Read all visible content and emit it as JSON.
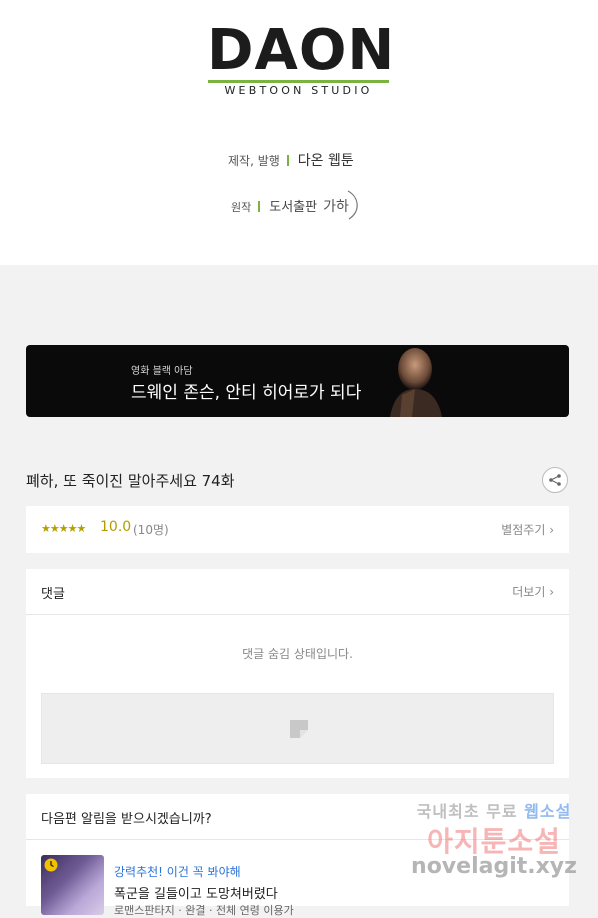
{
  "logo": {
    "word": "DAON",
    "subtitle": "WEBTOON STUDIO",
    "accent_color": "#7ab33f"
  },
  "credits": {
    "production_label": "제작, 발행",
    "production_value": "다온 웹툰",
    "original_label": "원작",
    "original_value": "도서출판",
    "publisher_mark": "가하"
  },
  "ad": {
    "kicker": "영화 블랙 아담",
    "title": "드웨인 존슨, 안티 히어로가 되다"
  },
  "episode": {
    "title": "폐하, 또 죽이진 말아주세요 74화",
    "share_icon": "share-icon"
  },
  "rating": {
    "stars": "★★★★★",
    "score": "10.0",
    "votes": "(10명)",
    "rate_link": "별점주기 ›",
    "star_color": "#b5a000"
  },
  "comments": {
    "title": "댓글",
    "more_link": "더보기 ›",
    "hidden_notice": "댓글 숨김 상태입니다."
  },
  "notify": {
    "question": "다음편 알림을 받으시겠습니까?",
    "reco_tag": "강력추천! 이건 꼭 봐야해",
    "reco_title": "폭군을 길들이고 도망쳐버렸다",
    "reco_meta": "로맨스판타지 · 완결 · 전체 연령 이용가",
    "tag_color": "#2b73d6"
  },
  "watermark": {
    "line1_a": "국내최초 무료",
    "line1_b": "웹소설",
    "line2": "아지툰소설",
    "line3": "novelagit.xyz"
  }
}
